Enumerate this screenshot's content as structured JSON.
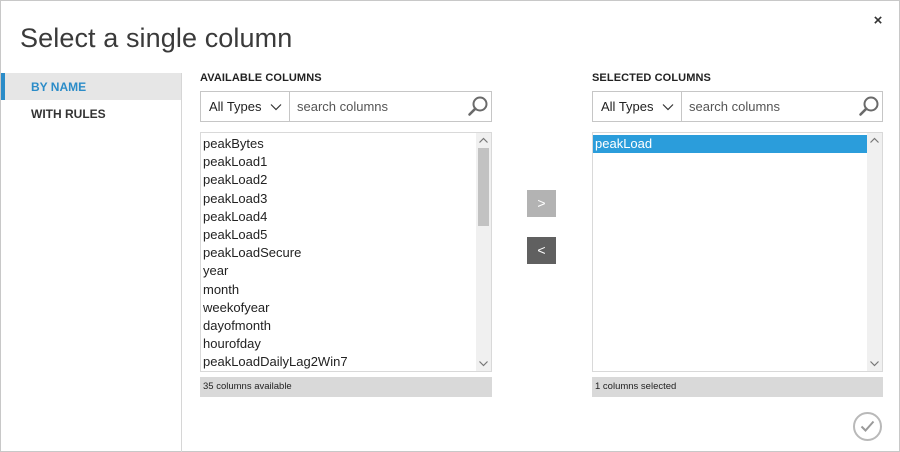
{
  "dialog": {
    "title": "Select a single column",
    "close_label": "×"
  },
  "nav": {
    "items": [
      {
        "label": "BY NAME",
        "active": true
      },
      {
        "label": "WITH RULES",
        "active": false
      }
    ]
  },
  "available": {
    "header": "AVAILABLE COLUMNS",
    "type_filter": "All Types",
    "search_placeholder": "search columns",
    "items": [
      "peakBytes",
      "peakLoad1",
      "peakLoad2",
      "peakLoad3",
      "peakLoad4",
      "peakLoad5",
      "peakLoadSecure",
      "year",
      "month",
      "weekofyear",
      "dayofmonth",
      "hourofday",
      "peakLoadDailyLag2Win7"
    ],
    "status": "35 columns available"
  },
  "selected": {
    "header": "SELECTED COLUMNS",
    "type_filter": "All Types",
    "search_placeholder": "search columns",
    "items": [
      "peakLoad"
    ],
    "status": "1 columns selected"
  },
  "actions": {
    "add_label": ">",
    "remove_label": "<"
  },
  "colors": {
    "accent": "#2b8cc8",
    "selection": "#2b9ddb",
    "remove_button": "#606060",
    "add_button_disabled": "#b3b3b3"
  }
}
